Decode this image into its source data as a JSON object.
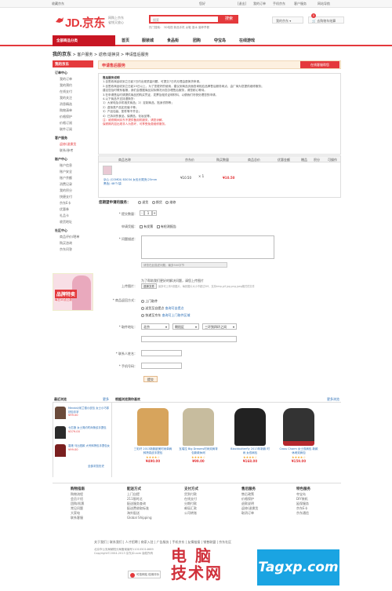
{
  "topbar": {
    "fav": "收藏京东",
    "user": "您好",
    "logout": "[退出]",
    "orders": "我的订单",
    "mobile": "手机京东",
    "service": "客户服务",
    "site": "网站导航"
  },
  "header": {
    "logo": "JD.京东",
    "slogan_line1": "网购上京东",
    "slogan_line2": "省钱又放心",
    "search_placeholder": "搜索",
    "search_button": "搜索",
    "hot_words": "热门搜索： 3D电视 新品手机 女鞋 香水 营养早餐",
    "myjd": "我的京东",
    "cart": "去购物车结算",
    "cart_count": "0"
  },
  "nav": {
    "category": "全部商品分类",
    "items": [
      "首页",
      "服装城",
      "食品街",
      "团购",
      "夺宝岛",
      "在线游戏"
    ]
  },
  "breadcrumb": {
    "title": "我的京东",
    "path": "> 客户服务 > 返修/退换货 > 申请售后服务"
  },
  "sidebar": {
    "title": "我的京东",
    "groups": [
      {
        "head": "订单中心",
        "items": [
          "我的订单",
          "我的预约",
          "在线支付",
          "我的关注",
          "消息精选",
          "购物清单",
          "价格保护",
          "价格订阅",
          "联件订阅"
        ]
      },
      {
        "head": "客户服务",
        "items": [
          "返修/退换货",
          "联系/参考"
        ]
      },
      {
        "head": "账户中心",
        "items": [
          "账户信息",
          "账户安全",
          "账户余额",
          "消费记录",
          "我的积分",
          "快捷支付",
          "京东E卡",
          "优惠券",
          "礼品卡",
          "收货地址"
        ]
      },
      {
        "head": "社区中心",
        "items": [
          "商品评价/晒单",
          "购买咨询",
          "京东问答"
        ]
      }
    ],
    "active": "返修/退换货",
    "promo_title": "品牌特卖",
    "promo_sub": "每日10点上新"
  },
  "panel": {
    "title": "申请售后服务",
    "button": "在线客服帮您"
  },
  "notice": {
    "heading": "售后服务说明",
    "lines": [
      "1.自签收商品收到之日起7日内出现质量问题，可提交7日内无理由退换货申请。",
      "2.自签收商品收到之日起15日以上，为了您更好的使用，建议到商品页面查询相应品牌售后服务网点，由厂商为您提供维修服务；",
      "   建议您及时联系客服，我们会根据商品实际情况为您办理售后服务，请您耐心等待。",
      "3.在申请售后时请提供商品的购买凭证、发票及相关证明材料，以便我们尽快处理您的申请。",
      "4.以下商品不支持退换货：",
      "  1）大家电及手机相关商品；2）定制商品、贴身衣物等；",
      "  2）虚拟类产品如充值卡等；",
      "  3）产品包装、配件等不齐全；",
      "  4）已拆封的食品、保健品、化妆品等。"
    ],
    "red_lines": [
      "注：维修期间京东不提供备用机服务，请您谅解。",
      "保修期内如出现非人为损坏，可享受免费维修服务。"
    ]
  },
  "product_table": {
    "headers": [
      "商品名称",
      "京东价",
      "购买数量",
      "商品总价",
      "优惠金额",
      "赠品",
      "积分",
      "可操作"
    ],
    "row": {
      "name": "京心 (COMDI) B3034 女包长尾夹(25mm黑色) 48个/袋",
      "jd_price": "¥10.50",
      "quantity": "1",
      "total": "¥10.50",
      "discount": "",
      "gift": "",
      "points": "",
      "op": ""
    }
  },
  "form": {
    "service_label": "您期望申请的服务：",
    "service_options": [
      "退货",
      "换货",
      "维修"
    ],
    "qty_label": "* 提交数量：",
    "qty_value": "1",
    "proof_label": "申请凭据：",
    "proof_options": [
      "有发票",
      "有检测报告"
    ],
    "desc_label": "* 问题描述：",
    "desc_hint": "请您在此描述问题，最多500字节",
    "upload_button": "选择文件",
    "upload_label": "上传图片：",
    "upload_hint": "为了帮助我们更好的解决问题，请您上传图片",
    "upload_note": "最多可上传5张图片，每张图片大小不超过5M，支持bmp,gif,jpg,png,jpeg格式的文件",
    "return_label": "* 商品返回方式：",
    "return_options": [
      "上门取件",
      "送货至自提点",
      "快递至京东"
    ],
    "return_links": [
      "查询可自提点",
      "查询可上门取件区域"
    ],
    "address_label": "* 取件地址：",
    "province": "北京",
    "city": "朝阳区",
    "district": "三环到四环之间",
    "contact_label": "* 联系人姓名：",
    "phone_label": "* 手机号码：",
    "submit": "提交"
  },
  "recent": {
    "title": "最近浏览",
    "more_left": "更多",
    "center_title": "根据浏览猜你喜欢",
    "more_right": "更多浏览",
    "left_items": [
      {
        "name": "Meraldi/米兰德小皮包 女士小巧零钱包手拿",
        "price": "¥99.00"
      },
      {
        "name": "七匹狼 女士简约时尚条纹手提包",
        "price": "¥379.00"
      },
      {
        "name": "香港 马比纽款 大号斜挎包手提包女",
        "price": "¥99.00"
      }
    ],
    "left_link": "全部浏览历史",
    "products": [
      {
        "name": "三彩纤 2013新款欧美时尚单肩斜挎真皮手提包",
        "price": "¥490.00",
        "rating": "4.5"
      },
      {
        "name": "瓦瑞拉 Big Dreams时尚双肩背包新款休闲",
        "price": "¥99.00",
        "rating": "4.5"
      },
      {
        "name": "Blackbutterfly 2013年新款 时尚 女双肩包",
        "price": "¥168.00",
        "rating": "4.5"
      },
      {
        "name": "Cross Charm 女士双肩包 新款休闲双肩包",
        "price": "¥159.00",
        "rating": "4.5"
      }
    ],
    "rating_text": "(已有评价)"
  },
  "footer": {
    "cols": [
      {
        "head": "购物指南",
        "items": [
          "购物流程",
          "会员介绍",
          "团购/机票",
          "常见问题",
          "大家电",
          "联系客服"
        ]
      },
      {
        "head": "配送方式",
        "items": [
          "上门自提",
          "211限时达",
          "配送服务查询",
          "配送费收取标准",
          "海外配送",
          "Global Shipping"
        ]
      },
      {
        "head": "支付方式",
        "items": [
          "货到付款",
          "在线支付",
          "分期付款",
          "邮局汇款",
          "公司转账"
        ]
      },
      {
        "head": "售后服务",
        "items": [
          "售后政策",
          "价格保护",
          "退款说明",
          "返修/退换货",
          "取消订单"
        ]
      },
      {
        "head": "特色服务",
        "items": [
          "夺宝岛",
          "DIY装机",
          "延保服务",
          "京东E卡",
          "京东通信"
        ]
      }
    ],
    "links": "关于我们 | 联系我们 | 人才招聘 | 商家入驻 | 广告服务 | 手机京东 | 友情链接 | 销售联盟 | 京东社区",
    "copyright1": "北京市公安局朝阳分局备案编号110105014669",
    "copyright2": "Copyright©2004-2013 京东JD.com 版权所有",
    "badge": "可信网站 信用评价"
  },
  "watermark": {
    "text1": "电  脑",
    "text2": "技术网",
    "text3": "Tagxp.com"
  }
}
